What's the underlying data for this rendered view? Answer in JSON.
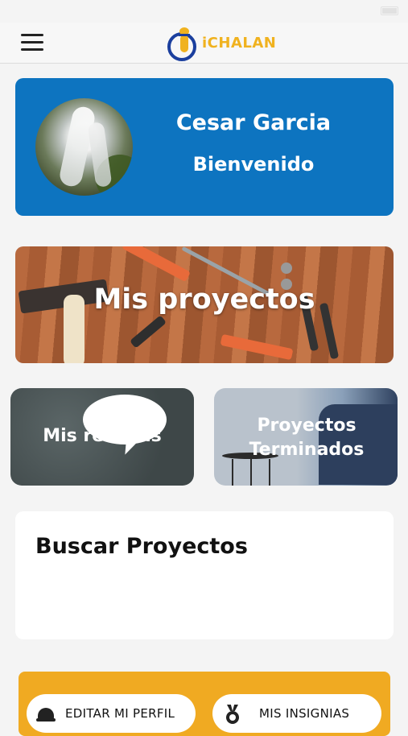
{
  "header": {
    "logo_text": "iCHALAN"
  },
  "profile": {
    "name": "Cesar Garcia",
    "greeting": "Bienvenido"
  },
  "cards": {
    "projects": "Mis proyectos",
    "reviews": "Mis reseñas",
    "finished": "Proyectos Terminados"
  },
  "search": {
    "title": "Buscar Proyectos"
  },
  "bottom": {
    "edit_profile": "EDITAR MI PERFIL",
    "badges": "MIS INSIGNIAS"
  },
  "colors": {
    "primary_blue": "#0d74c0",
    "accent_yellow": "#f0aa22"
  }
}
